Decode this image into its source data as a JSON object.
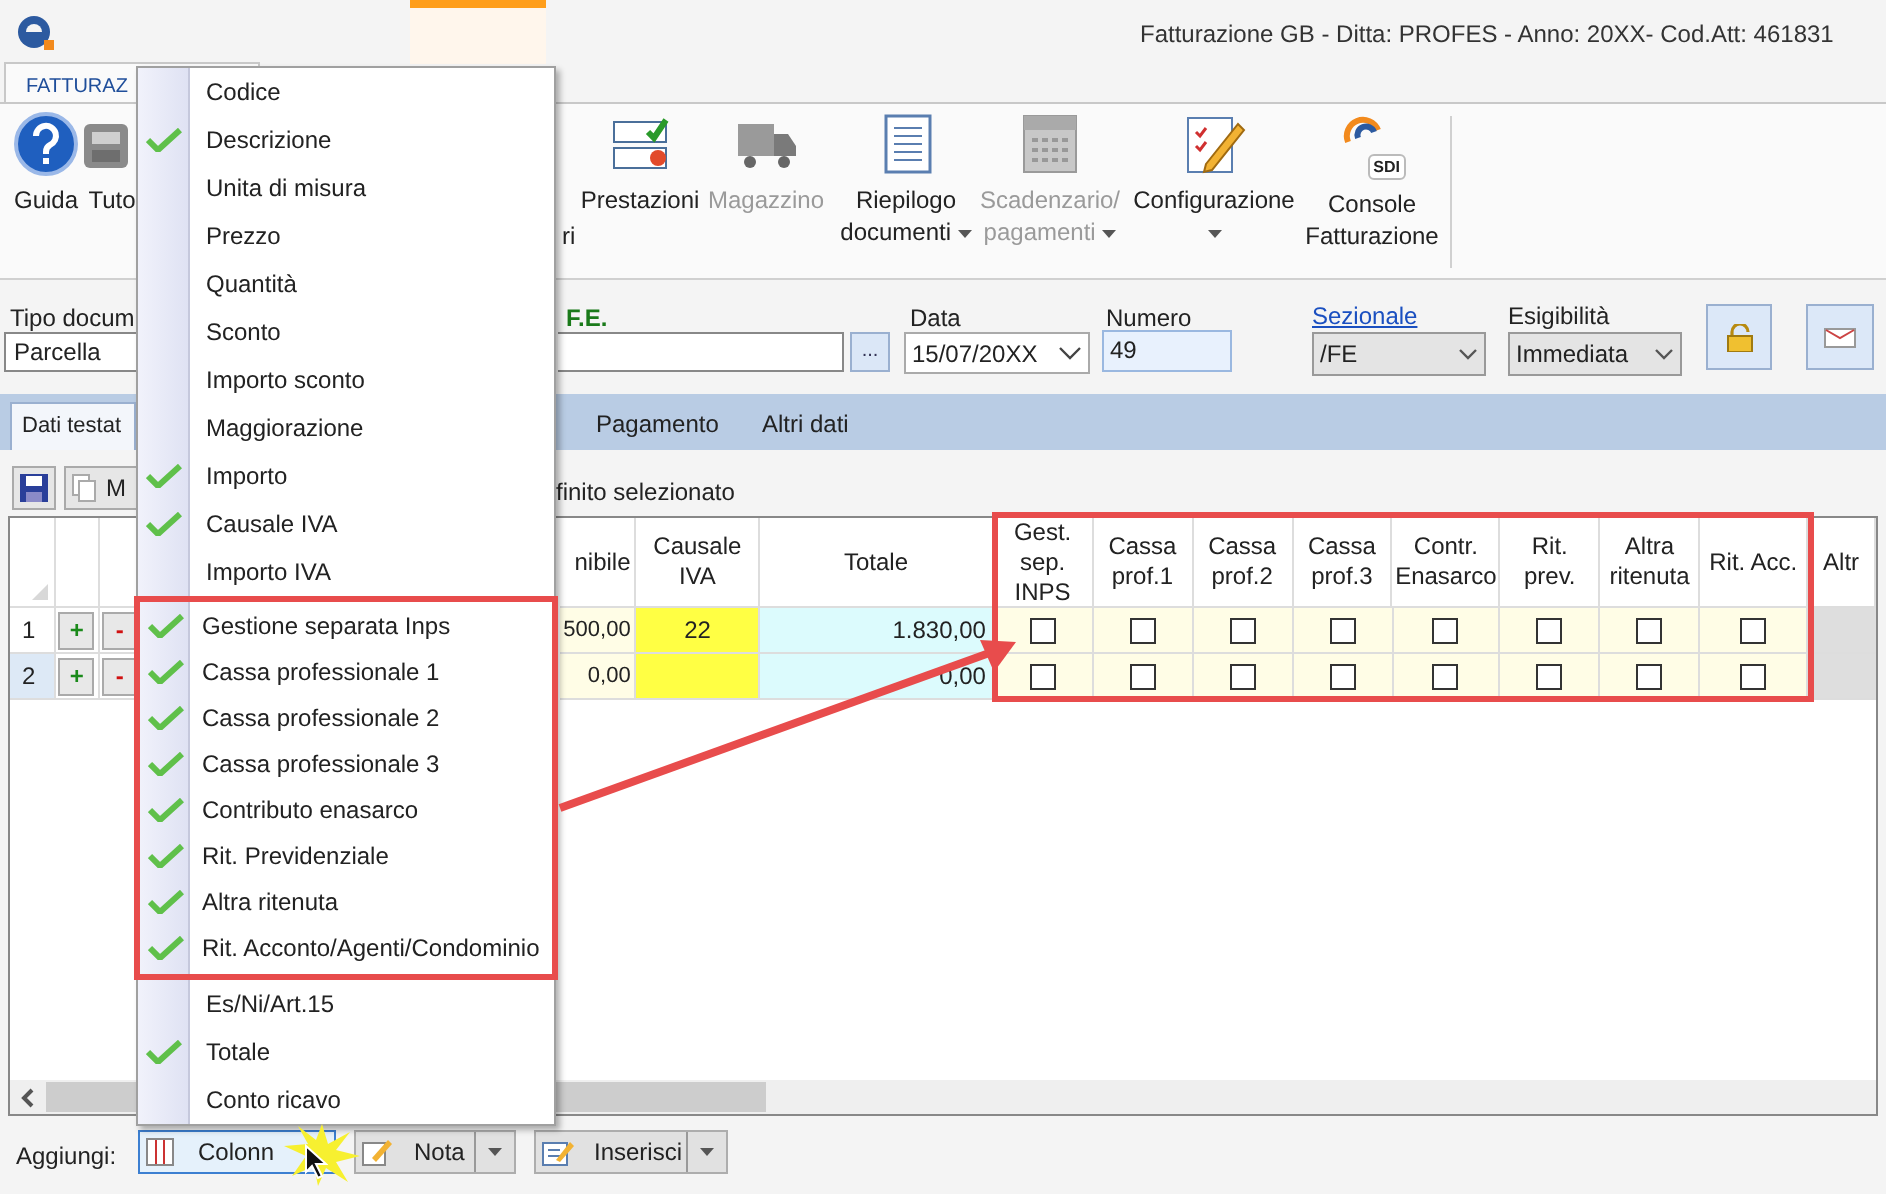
{
  "window": {
    "title": "Fatturazione GB - Ditta: PROFES - Anno: 20XX- Cod.Att: 461831"
  },
  "ribbon_tab": {
    "label": "FATTURAZ",
    "selected": true
  },
  "ribbon": [
    {
      "label": "Guida",
      "kind": "help",
      "disabled": false,
      "dropdown": false
    },
    {
      "label": "Tuto",
      "kind": "tutor",
      "disabled": false,
      "dropdown": false
    },
    {
      "label": "ri",
      "kind": "partial"
    },
    {
      "label": "Prestazioni",
      "kind": "checklist",
      "disabled": false,
      "dropdown": false
    },
    {
      "label": "Magazzino",
      "kind": "truck",
      "disabled": true,
      "dropdown": false
    },
    {
      "label": "Riepilogo documenti",
      "kind": "document",
      "disabled": false,
      "dropdown": true
    },
    {
      "label": "Scadenzario/ pagamenti",
      "kind": "calendar",
      "disabled": true,
      "dropdown": true
    },
    {
      "label": "Configurazione",
      "kind": "edit",
      "disabled": false,
      "dropdown": true
    },
    {
      "label": "Console Fatturazione",
      "kind": "console",
      "disabled": false,
      "dropdown": false,
      "badge": "SDI"
    }
  ],
  "form": {
    "tipo_label": "Tipo docum",
    "tipo_value": "Parcella",
    "fe_label": "F.E.",
    "browse": "...",
    "data_label": "Data",
    "data_value": "15/07/20XX",
    "numero_label": "Numero",
    "numero_value": "49",
    "sezionale_label": "Sezionale",
    "sezionale_value": "/FE",
    "esigibilita_label": "Esigibilità",
    "esigibilita_value": "Immediata"
  },
  "tabs": [
    {
      "label": "Dati testat",
      "selected": true
    },
    {
      "label": "Pagamento",
      "selected": false
    },
    {
      "label": "Altri dati",
      "selected": false
    }
  ],
  "toolbar": {
    "copy_label": "M",
    "text": "finito selezionato"
  },
  "grid": {
    "columns": [
      {
        "label": "nibile"
      },
      {
        "label": "Causale IVA"
      },
      {
        "label": "Totale"
      },
      {
        "label": "Gest. sep. INPS"
      },
      {
        "label": "Cassa prof.1"
      },
      {
        "label": "Cassa prof.2"
      },
      {
        "label": "Cassa prof.3"
      },
      {
        "label": "Contr. Enasarco"
      },
      {
        "label": "Rit. prev."
      },
      {
        "label": "Altra ritenuta"
      },
      {
        "label": "Rit. Acc."
      },
      {
        "label": "Altr"
      }
    ],
    "rows": [
      {
        "number": "1",
        "selected": false,
        "add": "+",
        "remove": "-",
        "imponibile": "500,00",
        "causale_iva": "22",
        "totale": "1.830,00",
        "flags": [
          {
            "checked": false
          },
          {
            "checked": false
          },
          {
            "checked": false
          },
          {
            "checked": false
          },
          {
            "checked": false
          },
          {
            "checked": false
          },
          {
            "checked": false
          },
          {
            "checked": false
          }
        ]
      },
      {
        "number": "2",
        "selected": true,
        "add": "+",
        "remove": "-",
        "imponibile": "0,00",
        "causale_iva": "",
        "totale": "0,00",
        "flags": [
          {
            "checked": false
          },
          {
            "checked": false
          },
          {
            "checked": false
          },
          {
            "checked": false
          },
          {
            "checked": false
          },
          {
            "checked": false
          },
          {
            "checked": false
          },
          {
            "checked": false
          }
        ]
      }
    ]
  },
  "bottom": {
    "label": "Aggiungi:",
    "buttons": [
      {
        "label": "Colonn",
        "kind": "columns",
        "dropdown": false,
        "pressed": true
      },
      {
        "label": "Nota",
        "kind": "note",
        "dropdown": true,
        "pressed": false
      },
      {
        "label": "Inserisci",
        "kind": "insert",
        "dropdown": true,
        "pressed": false
      }
    ]
  },
  "column_menu": {
    "items": [
      {
        "label": "Codice",
        "checked": false,
        "highlighted": false
      },
      {
        "label": "Descrizione",
        "checked": true,
        "highlighted": false
      },
      {
        "label": "Unita di misura",
        "checked": false,
        "highlighted": false
      },
      {
        "label": "Prezzo",
        "checked": false,
        "highlighted": false
      },
      {
        "label": "Quantità",
        "checked": false,
        "highlighted": false
      },
      {
        "label": "Sconto",
        "checked": false,
        "highlighted": false
      },
      {
        "label": "Importo sconto",
        "checked": false,
        "highlighted": false
      },
      {
        "label": "Maggiorazione",
        "checked": false,
        "highlighted": false
      },
      {
        "label": "Importo",
        "checked": true,
        "highlighted": false
      },
      {
        "label": "Causale IVA",
        "checked": true,
        "highlighted": false
      },
      {
        "label": "Importo IVA",
        "checked": false,
        "highlighted": false
      },
      {
        "label": "Gestione separata Inps",
        "checked": true,
        "highlighted": true
      },
      {
        "label": "Cassa professionale 1",
        "checked": true,
        "highlighted": true
      },
      {
        "label": "Cassa professionale 2",
        "checked": true,
        "highlighted": true
      },
      {
        "label": "Cassa professionale 3",
        "checked": true,
        "highlighted": true
      },
      {
        "label": "Contributo enasarco",
        "checked": true,
        "highlighted": true
      },
      {
        "label": "Rit. Previdenziale",
        "checked": true,
        "highlighted": true
      },
      {
        "label": "Altra ritenuta",
        "checked": true,
        "highlighted": true
      },
      {
        "label": "Rit. Acconto/Agenti/Condominio",
        "checked": true,
        "highlighted": true
      },
      {
        "label": "Es/Ni/Art.15",
        "checked": false,
        "highlighted": false
      },
      {
        "label": "Totale",
        "checked": true,
        "highlighted": false
      },
      {
        "label": "Conto ricavo",
        "checked": false,
        "highlighted": false
      }
    ]
  }
}
